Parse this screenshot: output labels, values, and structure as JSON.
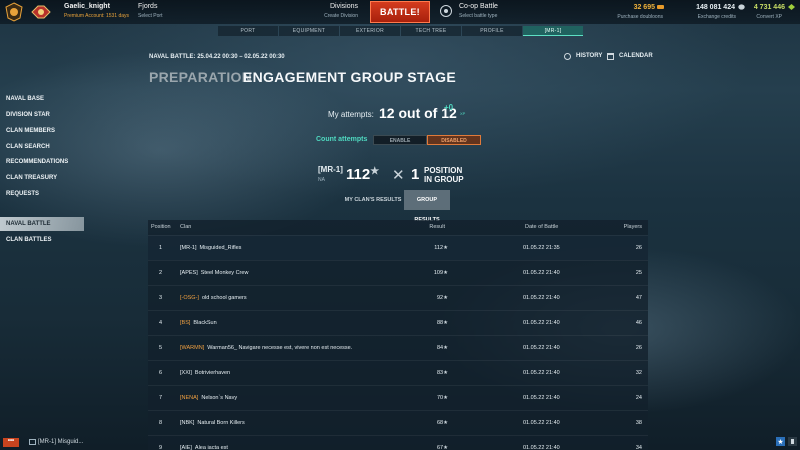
{
  "topbar": {
    "account_name": "Gaelic_knight",
    "account_sub": "Premium Account: 1531 days",
    "port_name": "Fjords",
    "port_sub": "Select Port",
    "divisions_name": "Divisions",
    "divisions_sub": "Create Division",
    "battle_label": "BATTLE!",
    "coop_name": "Co-op Battle",
    "coop_sub": "Select battle type",
    "doubloons": "32 695",
    "doubloons_sub": "Purchase doubloons",
    "credits": "148 081 424",
    "credits_sub": "Exchange credits",
    "free_xp": "4 731 446",
    "free_xp_sub": "Convert XP",
    "colors": {
      "doubloons": "#f0b23a",
      "credits": "#e6eef2",
      "free_xp": "#c7dc64"
    }
  },
  "nav_tabs": [
    "PORT",
    "EQUIPMENT",
    "EXTERIOR",
    "TECH TREE",
    "PROFILE",
    "[MR-1]"
  ],
  "header": {
    "dates": "NAVAL BATTLE: 25.04.22 00:30 – 02.05.22 00:30",
    "history": "HISTORY",
    "calendar": "CALENDAR",
    "stage_prev": "PREPARATION",
    "stage_current": "ENGAGEMENT GROUP STAGE"
  },
  "left_menu": [
    "NAVAL BASE",
    "DIVISION STAR",
    "CLAN MEMBERS",
    "CLAN SEARCH",
    "RECOMMENDATIONS",
    "CLAN TREASURY",
    "REQUESTS"
  ],
  "left_menu2": [
    "NAVAL BATTLE",
    "CLAN BATTLES"
  ],
  "attempts": {
    "label": "My attempts:",
    "value": "12 out of 12",
    "plus": "+0",
    "plus_sub": "XP",
    "count_label": "Count attempts",
    "enable": "ENABLE",
    "disabled": "DISABLED"
  },
  "clan_summary": {
    "tag": "[MR-1]",
    "realm": "NA",
    "result": "112",
    "position": "1",
    "position_label_1": "POSITION",
    "position_label_2": "IN GROUP"
  },
  "result_tabs": {
    "mine": "MY CLAN'S RESULTS",
    "group": "GROUP RESULTS"
  },
  "table": {
    "headers": [
      "Position",
      "Clan",
      "Result",
      "Date of Battle",
      "Players"
    ],
    "rows": [
      {
        "pos": "1",
        "tag": "[MR-1]",
        "tag_color": "#e6eef2",
        "name": "Misguided_Rifles",
        "result": "112",
        "date": "01.05.22 21:35",
        "players": "26"
      },
      {
        "pos": "2",
        "tag": "[APES]",
        "tag_color": "#e6eef2",
        "name": "Steel Monkey Crew",
        "result": "109",
        "date": "01.05.22 21:40",
        "players": "25"
      },
      {
        "pos": "3",
        "tag": "[-OSG-]",
        "tag_color": "#f0a040",
        "name": "old school gamers",
        "result": "92",
        "date": "01.05.22 21:40",
        "players": "47"
      },
      {
        "pos": "4",
        "tag": "[BS]",
        "tag_color": "#f0a040",
        "name": "BlackSun",
        "result": "88",
        "date": "01.05.22 21:40",
        "players": "46"
      },
      {
        "pos": "5",
        "tag": "[WARMN]",
        "tag_color": "#f0a040",
        "name": "Warman56_ Navigare necesse est, vivere non est necesse.",
        "result": "84",
        "date": "01.05.22 21:40",
        "players": "26"
      },
      {
        "pos": "6",
        "tag": "[XXI]",
        "tag_color": "#e6eef2",
        "name": "Botrivierhaven",
        "result": "83",
        "date": "01.05.22 21:40",
        "players": "32"
      },
      {
        "pos": "7",
        "tag": "[NENA]",
        "tag_color": "#f0a040",
        "name": "Nelson`s Navy",
        "result": "70",
        "date": "01.05.22 21:40",
        "players": "24"
      },
      {
        "pos": "8",
        "tag": "[NBK]",
        "tag_color": "#e6eef2",
        "name": "Natural Born Killers",
        "result": "68",
        "date": "01.05.22 21:40",
        "players": "38"
      },
      {
        "pos": "9",
        "tag": "[AIE]",
        "tag_color": "#e6eef2",
        "name": "Alea iacta est",
        "result": "67",
        "date": "01.05.22 21:40",
        "players": "34"
      }
    ]
  },
  "bottom": {
    "chat_button": "•••",
    "chat_text": "[MR-1] Misguid..."
  }
}
